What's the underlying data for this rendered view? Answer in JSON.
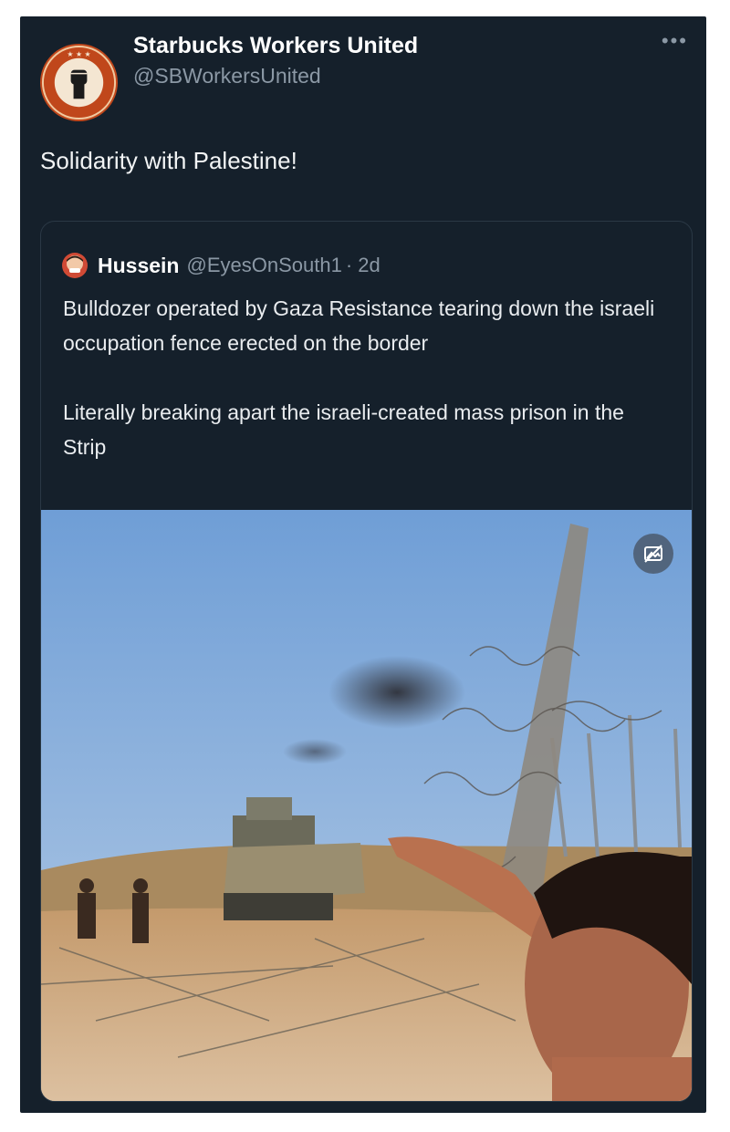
{
  "tweet": {
    "author": {
      "display_name": "Starbucks Workers United",
      "handle": "@SBWorkersUnited",
      "avatar_icon": "raised-fist-logo-icon"
    },
    "more_icon": "more-options-icon",
    "text": "Solidarity with Palestine!"
  },
  "quoted_tweet": {
    "author": {
      "display_name": "Hussein",
      "handle": "@EyesOnSouth1",
      "time": "· 2d",
      "avatar_icon": "avatar-icon"
    },
    "paragraph_1": "Bulldozer operated by Gaza Resistance tearing down the israeli occupation fence erected on the border",
    "paragraph_2": "Literally breaking apart the israeli-created mass prison in the Strip",
    "media": {
      "type": "photo",
      "badge_icon": "sensitive-media-icon"
    }
  },
  "colors": {
    "card_background": "#15202b",
    "secondary_text": "#8b98a5",
    "primary_text": "#ffffff"
  }
}
